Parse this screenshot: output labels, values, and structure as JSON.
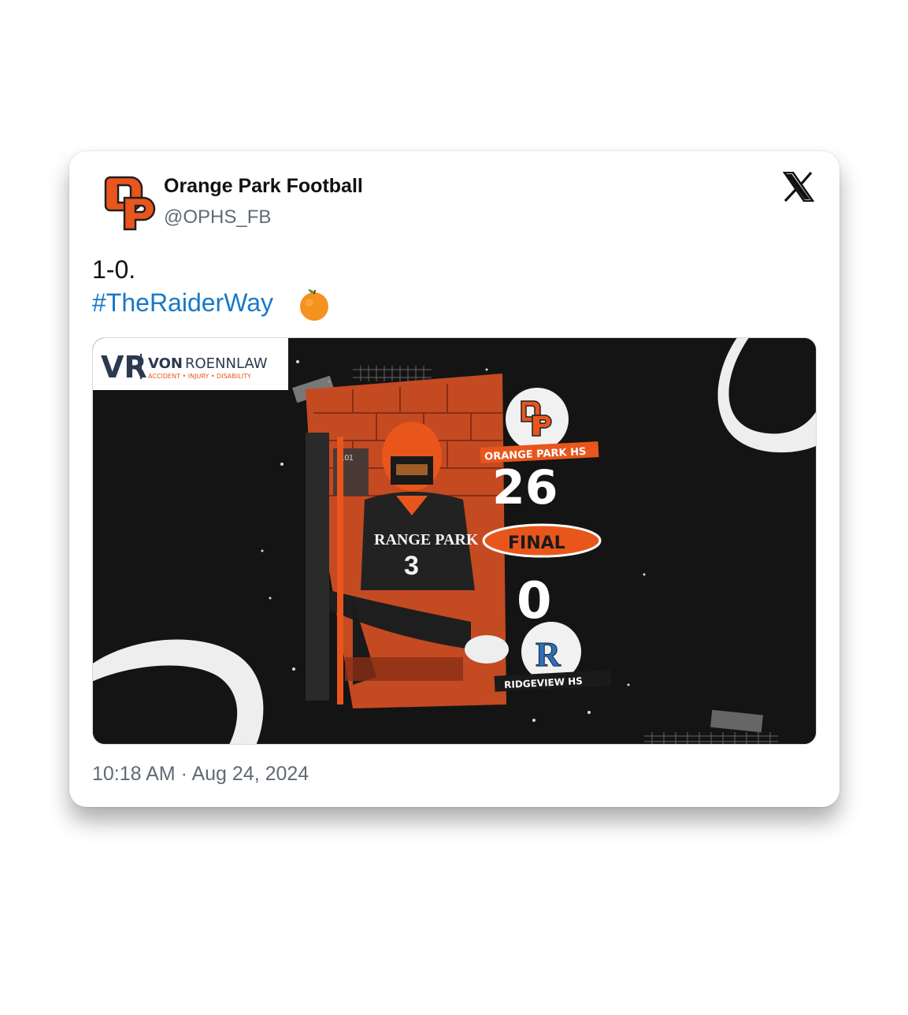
{
  "tweet": {
    "display_name": "Orange Park Football",
    "handle": "@OPHS_FB",
    "text_line1": "1-0.",
    "hashtag": "#TheRaiderWay",
    "timestamp": "10:18 AM · Aug 24, 2024"
  },
  "icons": {
    "avatar": "op-logo-icon",
    "platform": "x-logo-icon",
    "emoji": "tangerine-emoji-icon"
  },
  "media": {
    "sponsor_name_bold": "VON",
    "sponsor_name_rest": "ROENNLAW",
    "sponsor_tagline": "ACCIDENT • INJURY • DISABILITY",
    "sponsor_initials": "VR",
    "home_team": "ORANGE PARK HS",
    "home_score": "26",
    "status": "FINAL",
    "away_score": "0",
    "away_team": "RIDGEVIEW HS",
    "jersey_text": "RANGE PARK",
    "jersey_number": "3",
    "locker_number": "101"
  },
  "colors": {
    "brand_orange": "#e8561c",
    "link_blue": "#1878c8",
    "text_secondary": "#5f6b75"
  }
}
